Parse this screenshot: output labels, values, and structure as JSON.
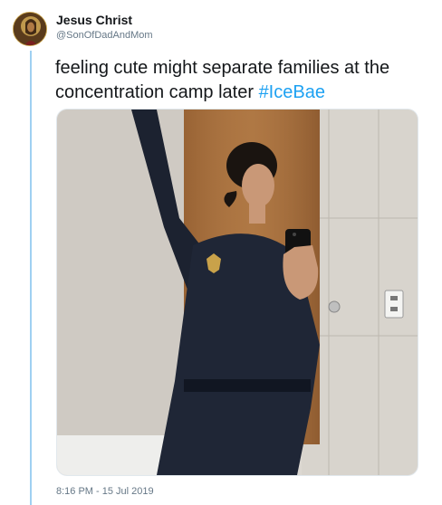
{
  "tweet": {
    "author_name": "Jesus Christ",
    "author_handle": "@SonOfDadAndMom",
    "text_plain": "feeling cute might separate families at the concentration camp later ",
    "hashtag": "#IceBae",
    "timestamp": "8:16 PM - 15 Jul 2019"
  },
  "colors": {
    "link": "#1da1f2",
    "thread_line": "#9fd0f2",
    "secondary_text": "#657786"
  }
}
